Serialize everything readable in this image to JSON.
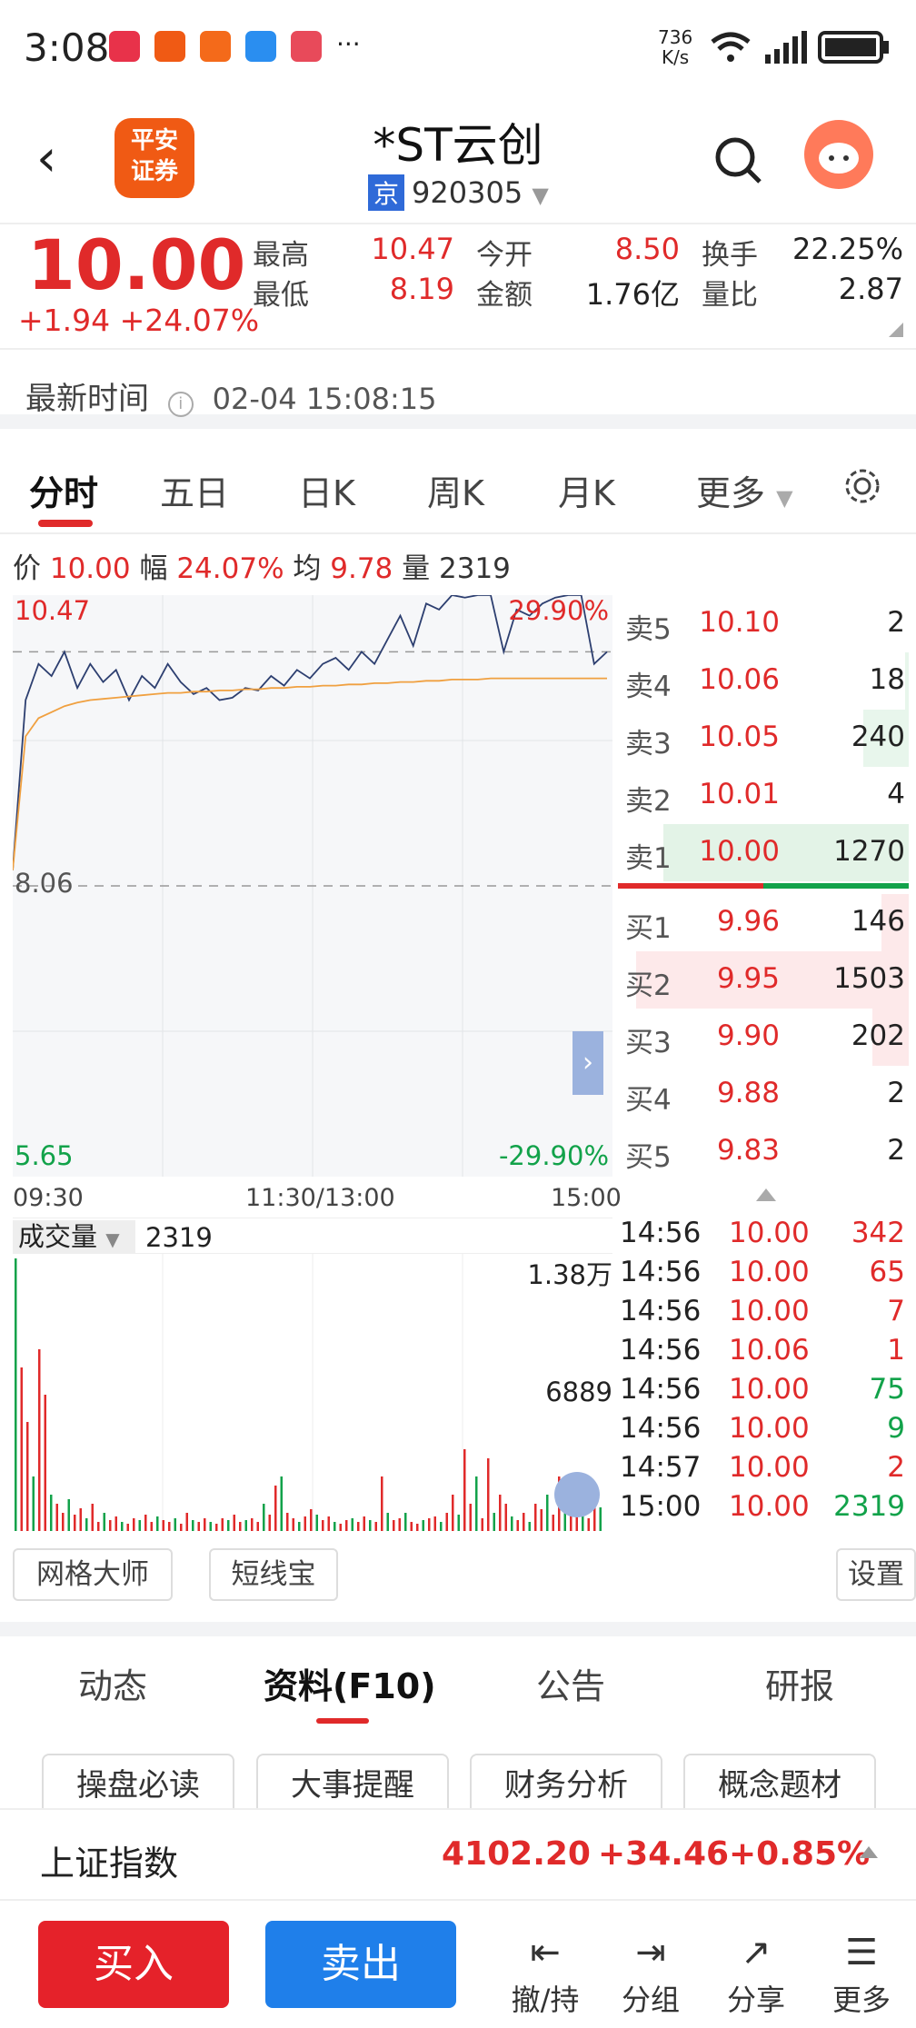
{
  "status": {
    "time": "3:08",
    "speed": "736\nK/s",
    "more": "···"
  },
  "header": {
    "title": "*ST云创",
    "exchange": "京",
    "code": "920305",
    "logo": "平安\n证券"
  },
  "quote": {
    "price": "10.00",
    "change": "+1.94",
    "pct": "+24.07%",
    "cells": [
      {
        "label": "最高",
        "value": "10.47",
        "color": "red"
      },
      {
        "label": "今开",
        "value": "8.50",
        "color": "red"
      },
      {
        "label": "换手",
        "value": "22.25%",
        "color": "dark"
      },
      {
        "label": "最低",
        "value": "8.19",
        "color": "red"
      },
      {
        "label": "金额",
        "value": "1.76亿",
        "color": "dark"
      },
      {
        "label": "量比",
        "value": "2.87",
        "color": "dark"
      }
    ]
  },
  "latest": {
    "label": "最新时间",
    "value": "02-04 15:08:15"
  },
  "tabs": [
    "分时",
    "五日",
    "日K",
    "周K",
    "月K",
    "更多"
  ],
  "info": {
    "price_label": "价",
    "price": "10.00",
    "amp_label": "幅",
    "amp": "24.07%",
    "avg_label": "均",
    "avg": "9.78",
    "vol_label": "量",
    "vol": "2319"
  },
  "chart": {
    "hi": "10.47",
    "hi_pct": "29.90%",
    "mid": "8.06",
    "lo": "5.65",
    "lo_pct": "-29.90%",
    "x_labels": [
      "09:30",
      "11:30/13:00",
      "15:00"
    ]
  },
  "chart_data": {
    "type": "line",
    "title": "",
    "ylim": [
      5.65,
      10.47
    ],
    "prev_close": 8.06,
    "series": [
      {
        "name": "价",
        "values": [
          8.19,
          9.6,
          9.9,
          9.8,
          10.0,
          9.7,
          9.9,
          9.75,
          9.85,
          9.6,
          9.8,
          9.7,
          9.9,
          9.75,
          9.65,
          9.7,
          9.6,
          9.62,
          9.7,
          9.68,
          9.8,
          9.72,
          9.85,
          9.78,
          9.9,
          9.95,
          9.85,
          10.0,
          9.9,
          10.1,
          10.3,
          10.05,
          10.4,
          10.35,
          10.47,
          10.45,
          10.47,
          10.47,
          10.0,
          10.35,
          10.3,
          10.4,
          10.45,
          10.47,
          10.47,
          9.9,
          10.0
        ]
      },
      {
        "name": "均",
        "values": [
          8.19,
          9.3,
          9.45,
          9.5,
          9.55,
          9.58,
          9.6,
          9.61,
          9.62,
          9.63,
          9.64,
          9.65,
          9.66,
          9.66,
          9.67,
          9.67,
          9.68,
          9.68,
          9.69,
          9.69,
          9.7,
          9.7,
          9.71,
          9.71,
          9.72,
          9.72,
          9.73,
          9.73,
          9.74,
          9.74,
          9.75,
          9.75,
          9.76,
          9.76,
          9.77,
          9.77,
          9.77,
          9.78,
          9.78,
          9.78,
          9.78,
          9.78,
          9.78,
          9.78,
          9.78,
          9.78,
          9.78
        ]
      }
    ]
  },
  "orderbook": {
    "sell": [
      {
        "label": "卖5",
        "price": "10.10",
        "vol": "2"
      },
      {
        "label": "卖4",
        "price": "10.06",
        "vol": "18"
      },
      {
        "label": "卖3",
        "price": "10.05",
        "vol": "240"
      },
      {
        "label": "卖2",
        "price": "10.01",
        "vol": "4"
      },
      {
        "label": "卖1",
        "price": "10.00",
        "vol": "1270"
      }
    ],
    "buy": [
      {
        "label": "买1",
        "price": "9.96",
        "vol": "146"
      },
      {
        "label": "买2",
        "price": "9.95",
        "vol": "1503"
      },
      {
        "label": "买3",
        "price": "9.90",
        "vol": "202"
      },
      {
        "label": "买4",
        "price": "9.88",
        "vol": "2"
      },
      {
        "label": "买5",
        "price": "9.83",
        "vol": "2"
      }
    ]
  },
  "volume": {
    "label": "成交量",
    "value": "2319",
    "max": "1.38万",
    "mid": "6889"
  },
  "trades": [
    {
      "t": "14:56",
      "p": "10.00",
      "v": "342",
      "c": "red"
    },
    {
      "t": "14:56",
      "p": "10.00",
      "v": "65",
      "c": "red"
    },
    {
      "t": "14:56",
      "p": "10.00",
      "v": "7",
      "c": "red"
    },
    {
      "t": "14:56",
      "p": "10.06",
      "v": "1",
      "c": "red"
    },
    {
      "t": "14:56",
      "p": "10.00",
      "v": "75",
      "c": "green"
    },
    {
      "t": "14:56",
      "p": "10.00",
      "v": "9",
      "c": "green"
    },
    {
      "t": "14:57",
      "p": "10.00",
      "v": "2",
      "c": "red"
    },
    {
      "t": "15:00",
      "p": "10.00",
      "v": "2319",
      "c": "green"
    }
  ],
  "tools": {
    "grid": "网格大师",
    "short": "短线宝",
    "settings": "设置"
  },
  "tabs2": [
    "动态",
    "资料(F10)",
    "公告",
    "研报"
  ],
  "subpills": [
    "操盘必读",
    "大事提醒",
    "财务分析",
    "概念题材"
  ],
  "index": {
    "name": "上证指数",
    "value": "4102.20",
    "change": "+34.46",
    "pct": "+0.85%"
  },
  "bottom": {
    "buy": "买入",
    "sell": "卖出",
    "items": [
      "撤/持",
      "分组",
      "分享",
      "更多"
    ]
  }
}
